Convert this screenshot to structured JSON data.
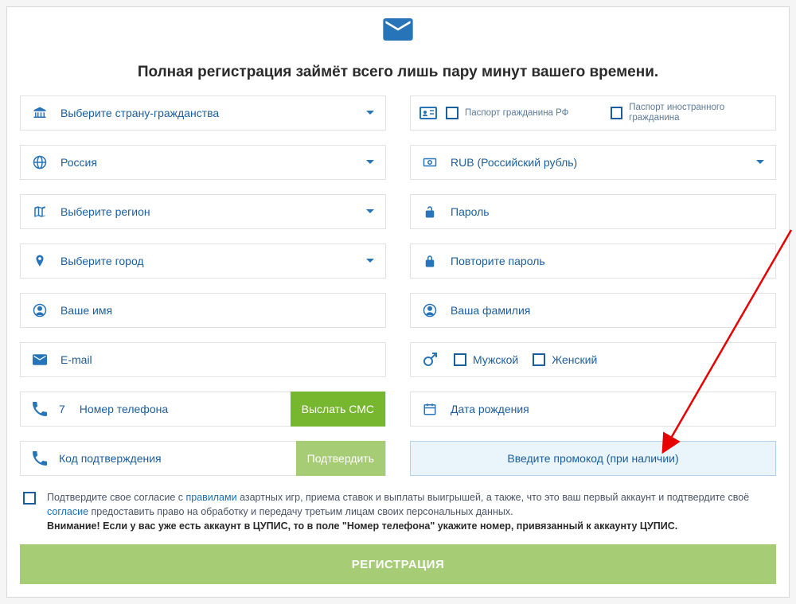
{
  "headline": "Полная регистрация займёт всего лишь пару минут вашего времени.",
  "left": {
    "citizenship": "Выберите страну-гражданства",
    "country": "Россия",
    "region": "Выберите регион",
    "city": "Выберите город",
    "firstname": "Ваше имя",
    "email": "E-mail",
    "phone_cc": "7",
    "phone_placeholder": "Номер телефона",
    "send_sms": "Выслать СМС",
    "confirm_code": "Код подтверждения",
    "confirm_btn": "Подтвердить"
  },
  "right": {
    "passport_rf": "Паспорт гражданина РФ",
    "passport_foreign": "Паспорт иностранного гражданина",
    "currency": "RUB (Российский рубль)",
    "password": "Пароль",
    "password_repeat": "Повторите пароль",
    "lastname": "Ваша фамилия",
    "gender_male": "Мужской",
    "gender_female": "Женский",
    "dob": "Дата рождения",
    "promo": "Введите промокод (при наличии)"
  },
  "consent": {
    "part1": "Подтвердите свое согласие с ",
    "rules_link": "правилами",
    "part2": " азартных игр, приема ставок и выплаты выигрышей, а также, что это ваш первый аккаунт и подтвердите своё ",
    "consent_link": "согласие",
    "part3": " предоставить право на обработку и передачу третьим лицам своих персональных данных.",
    "warning": "Внимание! Если у вас уже есть аккаунт в ЦУПИС, то в поле \"Номер телефона\" укажите номер, привязанный к аккаунту ЦУПИС."
  },
  "submit": "РЕГИСТРАЦИЯ",
  "colors": {
    "primary": "#1a5e9e",
    "icon": "#2874b8"
  }
}
